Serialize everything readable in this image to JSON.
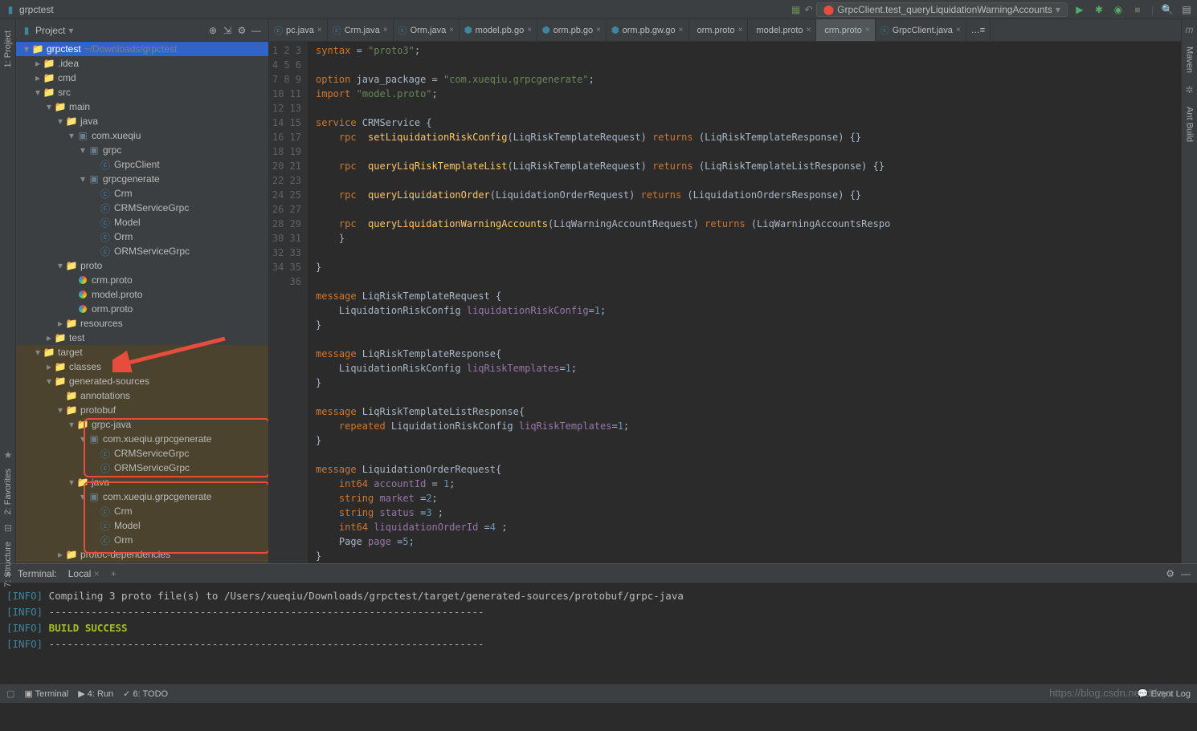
{
  "top": {
    "project": "grpctest",
    "run_config": "GrpcClient.test_queryLiquidationWarningAccounts"
  },
  "project_panel": {
    "title": "Project",
    "root": {
      "name": "grpctest",
      "path": "~/Downloads/grpctest"
    },
    "tree": [
      {
        "depth": 0,
        "arrow": "down",
        "icon": "folder-blue",
        "label": "grpctest",
        "path": "~/Downloads/grpctest",
        "selected": true
      },
      {
        "depth": 1,
        "arrow": "right",
        "icon": "folder",
        "label": ".idea"
      },
      {
        "depth": 1,
        "arrow": "right",
        "icon": "folder",
        "label": "cmd"
      },
      {
        "depth": 1,
        "arrow": "down",
        "icon": "folder",
        "label": "src"
      },
      {
        "depth": 2,
        "arrow": "down",
        "icon": "folder",
        "label": "main"
      },
      {
        "depth": 3,
        "arrow": "down",
        "icon": "folder-blue",
        "label": "java"
      },
      {
        "depth": 4,
        "arrow": "down",
        "icon": "pkg",
        "label": "com.xueqiu"
      },
      {
        "depth": 5,
        "arrow": "down",
        "icon": "pkg",
        "label": "grpc"
      },
      {
        "depth": 6,
        "arrow": "",
        "icon": "class",
        "label": "GrpcClient"
      },
      {
        "depth": 5,
        "arrow": "down",
        "icon": "pkg",
        "label": "grpcgenerate"
      },
      {
        "depth": 6,
        "arrow": "",
        "icon": "class",
        "label": "Crm"
      },
      {
        "depth": 6,
        "arrow": "",
        "icon": "class",
        "label": "CRMServiceGrpc"
      },
      {
        "depth": 6,
        "arrow": "",
        "icon": "class",
        "label": "Model"
      },
      {
        "depth": 6,
        "arrow": "",
        "icon": "class",
        "label": "Orm"
      },
      {
        "depth": 6,
        "arrow": "",
        "icon": "class",
        "label": "ORMServiceGrpc"
      },
      {
        "depth": 3,
        "arrow": "down",
        "icon": "folder",
        "label": "proto"
      },
      {
        "depth": 4,
        "arrow": "",
        "icon": "rainbow",
        "label": "crm.proto"
      },
      {
        "depth": 4,
        "arrow": "",
        "icon": "rainbow",
        "label": "model.proto"
      },
      {
        "depth": 4,
        "arrow": "",
        "icon": "rainbow",
        "label": "orm.proto"
      },
      {
        "depth": 3,
        "arrow": "right",
        "icon": "folder",
        "label": "resources"
      },
      {
        "depth": 2,
        "arrow": "right",
        "icon": "folder",
        "label": "test"
      },
      {
        "depth": 1,
        "arrow": "down",
        "icon": "folder-orange",
        "label": "target",
        "highlight": true
      },
      {
        "depth": 2,
        "arrow": "right",
        "icon": "folder-orange",
        "label": "classes",
        "highlight": true
      },
      {
        "depth": 2,
        "arrow": "down",
        "icon": "folder-orange",
        "label": "generated-sources",
        "highlight": true
      },
      {
        "depth": 3,
        "arrow": "",
        "icon": "folder-orange",
        "label": "annotations",
        "highlight": true
      },
      {
        "depth": 3,
        "arrow": "down",
        "icon": "folder-orange",
        "label": "protobuf",
        "highlight": true
      },
      {
        "depth": 4,
        "arrow": "down",
        "icon": "folder-blue",
        "label": "grpc-java",
        "highlight": true
      },
      {
        "depth": 5,
        "arrow": "down",
        "icon": "pkg",
        "label": "com.xueqiu.grpcgenerate",
        "highlight": true
      },
      {
        "depth": 6,
        "arrow": "",
        "icon": "class",
        "label": "CRMServiceGrpc",
        "highlight": true
      },
      {
        "depth": 6,
        "arrow": "",
        "icon": "class",
        "label": "ORMServiceGrpc",
        "highlight": true
      },
      {
        "depth": 4,
        "arrow": "down",
        "icon": "folder-blue",
        "label": "java",
        "highlight": true
      },
      {
        "depth": 5,
        "arrow": "down",
        "icon": "pkg",
        "label": "com.xueqiu.grpcgenerate",
        "highlight": true
      },
      {
        "depth": 6,
        "arrow": "",
        "icon": "class",
        "label": "Crm",
        "highlight": true
      },
      {
        "depth": 6,
        "arrow": "",
        "icon": "class",
        "label": "Model",
        "highlight": true
      },
      {
        "depth": 6,
        "arrow": "",
        "icon": "class",
        "label": "Orm",
        "highlight": true
      },
      {
        "depth": 3,
        "arrow": "right",
        "icon": "folder",
        "label": "protoc-dependencies",
        "highlight": true
      }
    ]
  },
  "editor": {
    "tabs": [
      {
        "label": "pc.java",
        "icon": "java"
      },
      {
        "label": "Crm.java",
        "icon": "java"
      },
      {
        "label": "Orm.java",
        "icon": "java"
      },
      {
        "label": "model.pb.go",
        "icon": "go"
      },
      {
        "label": "orm.pb.go",
        "icon": "go"
      },
      {
        "label": "orm.pb.gw.go",
        "icon": "go"
      },
      {
        "label": "orm.proto",
        "icon": "rainbow"
      },
      {
        "label": "model.proto",
        "icon": "rainbow"
      },
      {
        "label": "crm.proto",
        "icon": "rainbow",
        "active": true
      },
      {
        "label": "GrpcClient.java",
        "icon": "java"
      }
    ],
    "lines": [
      {
        "n": 1,
        "html": "<span class='kw'>syntax</span> = <span class='str'>\"proto3\"</span>;"
      },
      {
        "n": 2,
        "html": ""
      },
      {
        "n": 3,
        "html": "<span class='kw'>option</span> java_package = <span class='str'>\"com.xueqiu.grpcgenerate\"</span>;"
      },
      {
        "n": 4,
        "html": "<span class='kw'>import</span> <span class='str'>\"model.proto\"</span>;"
      },
      {
        "n": 5,
        "html": ""
      },
      {
        "n": 6,
        "html": "<span class='kw'>service</span> CRMService {"
      },
      {
        "n": 7,
        "html": "    <span class='kw'>rpc</span>  <span class='fn'>setLiquidationRiskConfig</span>(LiqRiskTemplateRequest) <span class='kw'>returns</span> (LiqRiskTemplateResponse) {}"
      },
      {
        "n": 8,
        "html": ""
      },
      {
        "n": 9,
        "html": "    <span class='kw'>rpc</span>  <span class='fn'>queryLiqRiskTemplateList</span>(LiqRiskTemplateRequest) <span class='kw'>returns</span> (LiqRiskTemplateListResponse) {}"
      },
      {
        "n": 10,
        "html": ""
      },
      {
        "n": 11,
        "html": "    <span class='kw'>rpc</span>  <span class='fn'>queryLiquidationOrder</span>(LiquidationOrderRequest) <span class='kw'>returns</span> (LiquidationOrdersResponse) {}"
      },
      {
        "n": 12,
        "html": ""
      },
      {
        "n": 13,
        "html": "    <span class='kw'>rpc</span>  <span class='fn'>queryLiquidationWarningAccounts</span>(LiqWarningAccountRequest) <span class='kw'>returns</span> (LiqWarningAccountsRespo"
      },
      {
        "n": 14,
        "html": "    }"
      },
      {
        "n": 15,
        "html": ""
      },
      {
        "n": 16,
        "html": "}"
      },
      {
        "n": 17,
        "html": ""
      },
      {
        "n": 18,
        "html": "<span class='kw'>message</span> LiqRiskTemplateRequest {"
      },
      {
        "n": 19,
        "html": "    LiquidationRiskConfig <span class='ident'>liquidationRiskConfig</span>=<span class='num'>1</span>;"
      },
      {
        "n": 20,
        "html": "}"
      },
      {
        "n": 21,
        "html": ""
      },
      {
        "n": 22,
        "html": "<span class='kw'>message</span> LiqRiskTemplateResponse{"
      },
      {
        "n": 23,
        "html": "    LiquidationRiskConfig <span class='ident'>liqRiskTemplates</span>=<span class='num'>1</span>;"
      },
      {
        "n": 24,
        "html": "}"
      },
      {
        "n": 25,
        "html": ""
      },
      {
        "n": 26,
        "html": "<span class='kw'>message</span> LiqRiskTemplateListResponse{"
      },
      {
        "n": 27,
        "html": "    <span class='kw'>repeated</span> LiquidationRiskConfig <span class='ident'>liqRiskTemplates</span>=<span class='num'>1</span>;"
      },
      {
        "n": 28,
        "html": "}"
      },
      {
        "n": 29,
        "html": ""
      },
      {
        "n": 30,
        "html": "<span class='kw'>message</span> LiquidationOrderRequest{"
      },
      {
        "n": 31,
        "html": "    <span class='kw'>int64</span> <span class='ident'>accountId</span> = <span class='num'>1</span>;"
      },
      {
        "n": 32,
        "html": "    <span class='kw'>string</span> <span class='ident'>market</span> =<span class='num'>2</span>;"
      },
      {
        "n": 33,
        "html": "    <span class='kw'>string</span> <span class='ident'>status</span> =<span class='num'>3</span> ;"
      },
      {
        "n": 34,
        "html": "    <span class='kw'>int64</span> <span class='ident'>liquidationOrderId</span> =<span class='num'>4</span> ;"
      },
      {
        "n": 35,
        "html": "    Page <span class='ident'>page</span> =<span class='num'>5</span>;"
      },
      {
        "n": 36,
        "html": "}"
      }
    ]
  },
  "terminal": {
    "title": "Terminal:",
    "tab": "Local",
    "lines": [
      {
        "prefix": "[INFO]",
        "text": " Compiling 3 proto file(s) to /Users/xueqiu/Downloads/grpctest/target/generated-sources/protobuf/grpc-java"
      },
      {
        "prefix": "[INFO]",
        "text": " ------------------------------------------------------------------------"
      },
      {
        "prefix": "[INFO]",
        "text": " BUILD SUCCESS",
        "success": true
      },
      {
        "prefix": "[INFO]",
        "text": " ------------------------------------------------------------------------"
      }
    ]
  },
  "status": {
    "terminal": "Terminal",
    "run": "4: Run",
    "todo": "6: TODO",
    "event_log": "Event Log"
  },
  "left_labels": {
    "project": "1: Project"
  },
  "left_lower_labels": {
    "favorites": "2: Favorites",
    "structure": "7: Structure"
  },
  "right_labels": {
    "maven": "Maven",
    "ant": "Ant Build"
  },
  "watermark": "https://blog.csdn.net/ddzyx"
}
